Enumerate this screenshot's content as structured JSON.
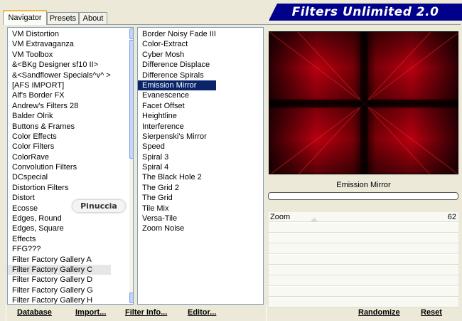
{
  "tabs": [
    "Navigator",
    "Presets",
    "About"
  ],
  "active_tab": 0,
  "banner": {
    "title": "Filters Unlimited 2.0"
  },
  "categories": {
    "items": [
      "VM Distortion",
      "VM Extravaganza",
      "VM Toolbox",
      "&<BKg Designer sf10 II>",
      "&<Sandflower Specials^v^ >",
      "[AFS IMPORT]",
      "Alf's Border FX",
      "Andrew's Filters 28",
      "Balder Olrik",
      "Buttons & Frames",
      "Color Effects",
      "Color Filters",
      "ColorRave",
      "Convolution Filters",
      "DCspecial",
      "Distortion Filters",
      "Distort",
      "Ecosse",
      "Edges, Round",
      "Edges, Square",
      "Effects",
      "FFG???",
      "Filter Factory Gallery A",
      "Filter Factory Gallery C",
      "Filter Factory Gallery D",
      "Filter Factory Gallery G",
      "Filter Factory Gallery H"
    ],
    "highlighted_index": 23
  },
  "filters": {
    "items": [
      "Border Noisy Fade III",
      "Color-Extract",
      "Cyber Mosh",
      "Difference Displace",
      "Difference Spirals",
      "Emission Mirror",
      "Evanescence",
      "Facet Offset",
      "Heightline",
      "Interference",
      "Sierpenski's Mirror",
      "Speed",
      "Spiral 3",
      "Spiral 4",
      "The Black Hole 2",
      "The Grid 2",
      "The Grid",
      "Tile Mix",
      "Versa-Tile",
      "Zoom Noise"
    ],
    "selected_index": 5
  },
  "preview": {
    "effect_name": "Emission Mirror",
    "progress": 0
  },
  "params": [
    {
      "name": "Zoom",
      "value": "62"
    }
  ],
  "buttons": {
    "database": "Database",
    "import": "Import...",
    "filter_info": "Filter Info...",
    "editor": "Editor...",
    "randomize": "Randomize",
    "reset": "Reset"
  },
  "watermark": "Pinuccia",
  "colors": {
    "accent": "#00008b",
    "selection": "#0a246a",
    "preview_red": "#b0000f"
  }
}
